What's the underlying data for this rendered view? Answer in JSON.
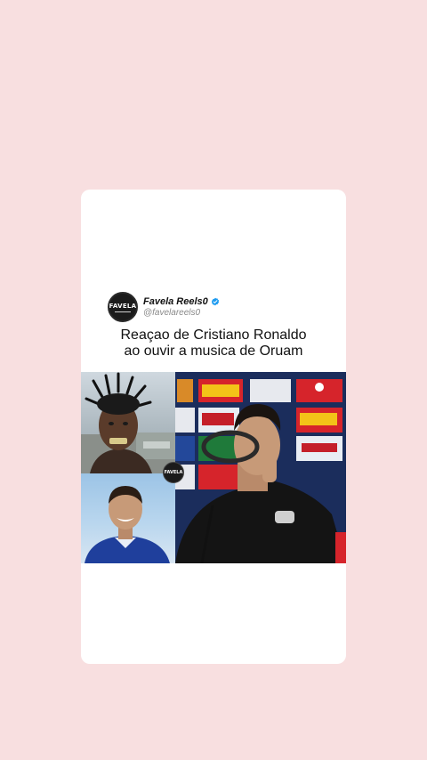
{
  "post": {
    "display_name": "Favela Reels0",
    "handle": "@favelareels0",
    "avatar_text": "FAVELA",
    "verified": true,
    "caption_line1": "Reaçao de Cristiano Ronaldo",
    "caption_line2": "ao ouvir a musica de Oruam"
  },
  "media": {
    "badge_text": "FAVELA"
  },
  "icons": {
    "verified": "verified-badge-icon"
  },
  "colors": {
    "page_background": "#f8dfe0",
    "card_background": "#ffffff",
    "verified_blue": "#1d9bf0"
  }
}
